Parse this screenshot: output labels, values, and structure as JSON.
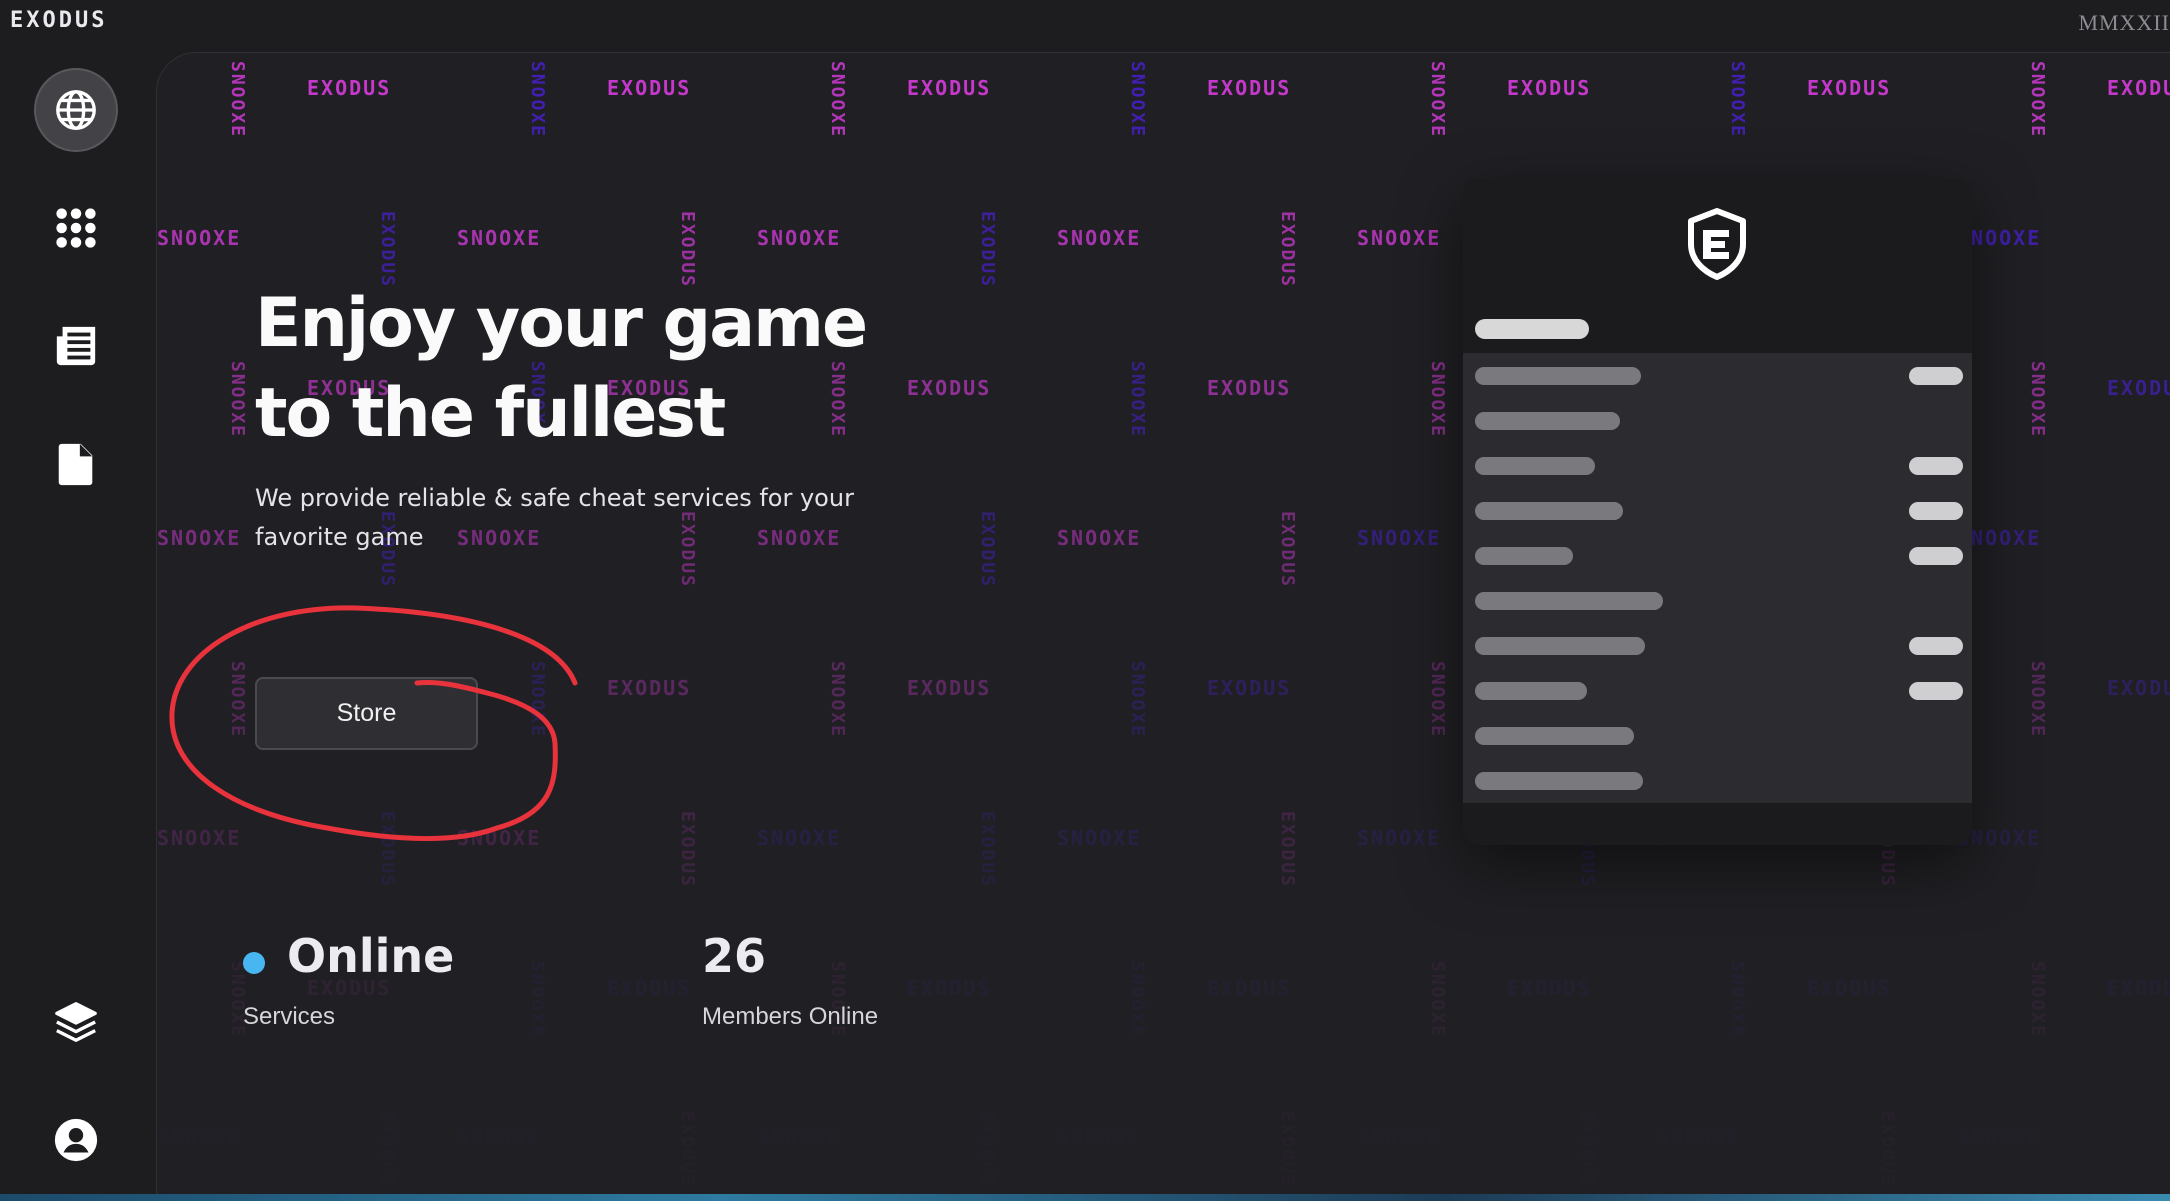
{
  "header": {
    "brand": "EXODUS",
    "roman": "MMXXII"
  },
  "sidebar": {
    "items": [
      {
        "icon": "globe-icon",
        "active": true
      },
      {
        "icon": "grid-dots-icon",
        "active": false
      },
      {
        "icon": "newspaper-icon",
        "active": false
      },
      {
        "icon": "document-icon",
        "active": false
      },
      {
        "icon": "layers-icon",
        "active": false
      },
      {
        "icon": "user-circle-icon",
        "active": false
      }
    ]
  },
  "hero": {
    "title_line1": "Enjoy your game",
    "title_line2": "to the fullest",
    "subtitle": "We provide reliable & safe cheat services for your favorite game",
    "store_button": "Store"
  },
  "stats": {
    "services_value": "Online",
    "services_label": "Services",
    "members_value": "26",
    "members_label": "Members Online"
  },
  "pattern_words": [
    "EXODUS",
    "SNOOXE"
  ],
  "colors": {
    "accent_blue": "#48b6f0",
    "pattern_magenta": "#d23ad8",
    "pattern_violet": "#4a1fd0",
    "annotation_red": "#e8333c"
  }
}
